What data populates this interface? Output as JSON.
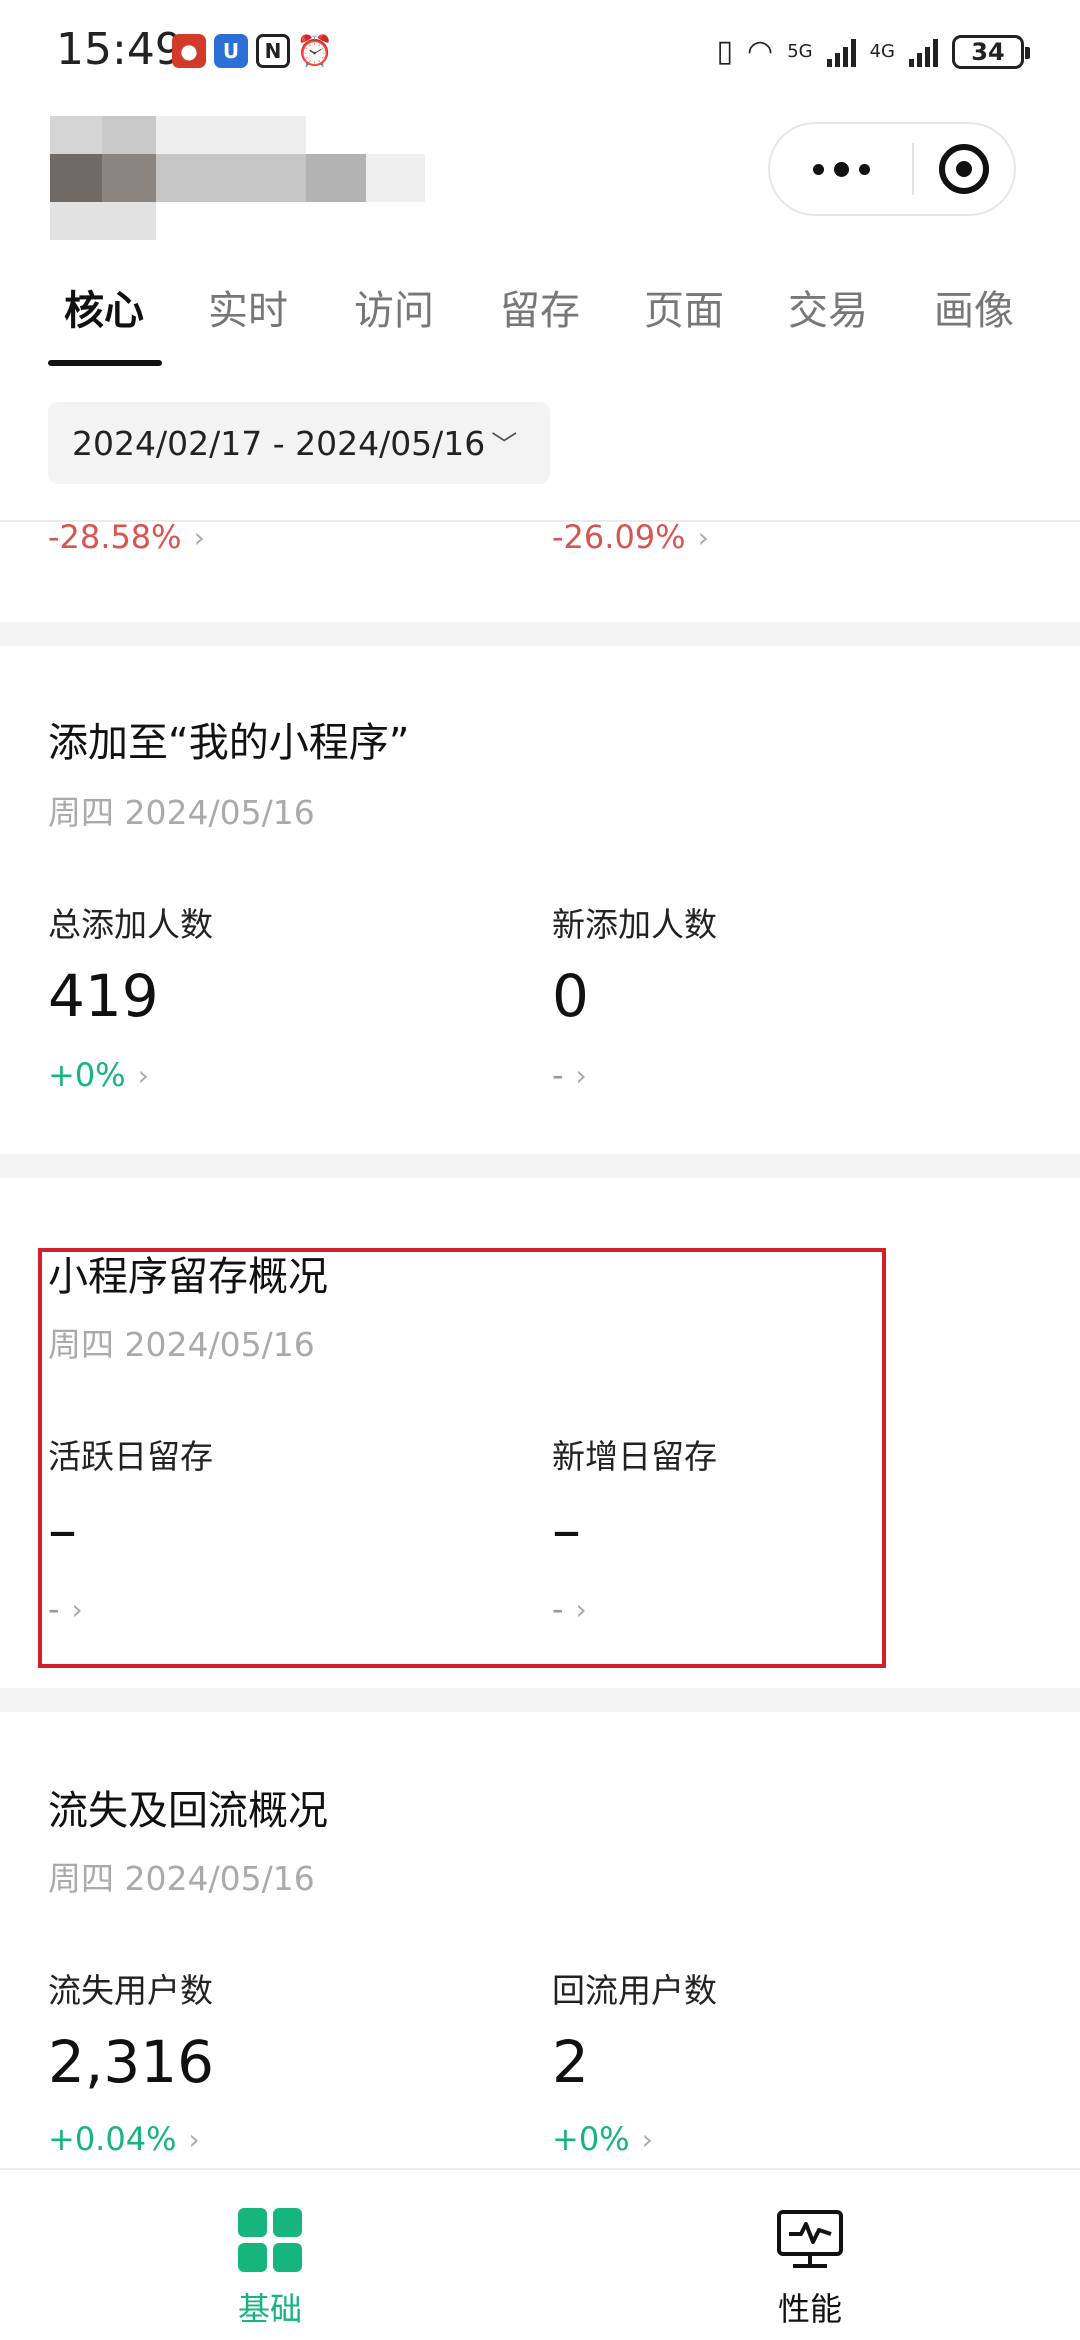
{
  "status_bar": {
    "time": "15:49",
    "network_5g": "5G",
    "network_4g": "4G",
    "battery": "34"
  },
  "tabs": [
    "核心",
    "实时",
    "访问",
    "留存",
    "页面",
    "交易",
    "画像"
  ],
  "date_range": "2024/02/17 - 2024/05/16",
  "partial_row": {
    "left_change": "-28.58%",
    "right_change": "-26.09%"
  },
  "sections": {
    "add_to_my_apps": {
      "title": "添加至“我的小程序”",
      "date": "周四 2024/05/16",
      "left": {
        "label": "总添加人数",
        "value": "419",
        "change": "+0%"
      },
      "right": {
        "label": "新添加人数",
        "value": "0",
        "change": "-"
      }
    },
    "retention": {
      "title": "小程序留存概况",
      "date": "周四 2024/05/16",
      "left": {
        "label": "活跃日留存",
        "value": "–",
        "change": "-"
      },
      "right": {
        "label": "新增日留存",
        "value": "–",
        "change": "-"
      }
    },
    "churn": {
      "title": "流失及回流概况",
      "date": "周四 2024/05/16",
      "left": {
        "label": "流失用户数",
        "value": "2,316",
        "change": "+0.04%"
      },
      "right": {
        "label": "回流用户数",
        "value": "2",
        "change": "+0%"
      }
    }
  },
  "bottom_nav": {
    "basic": "基础",
    "performance": "性能"
  },
  "colors": {
    "accent_green": "#16b57d",
    "negative_red": "#d9534f",
    "highlight_red": "#d4202a"
  }
}
